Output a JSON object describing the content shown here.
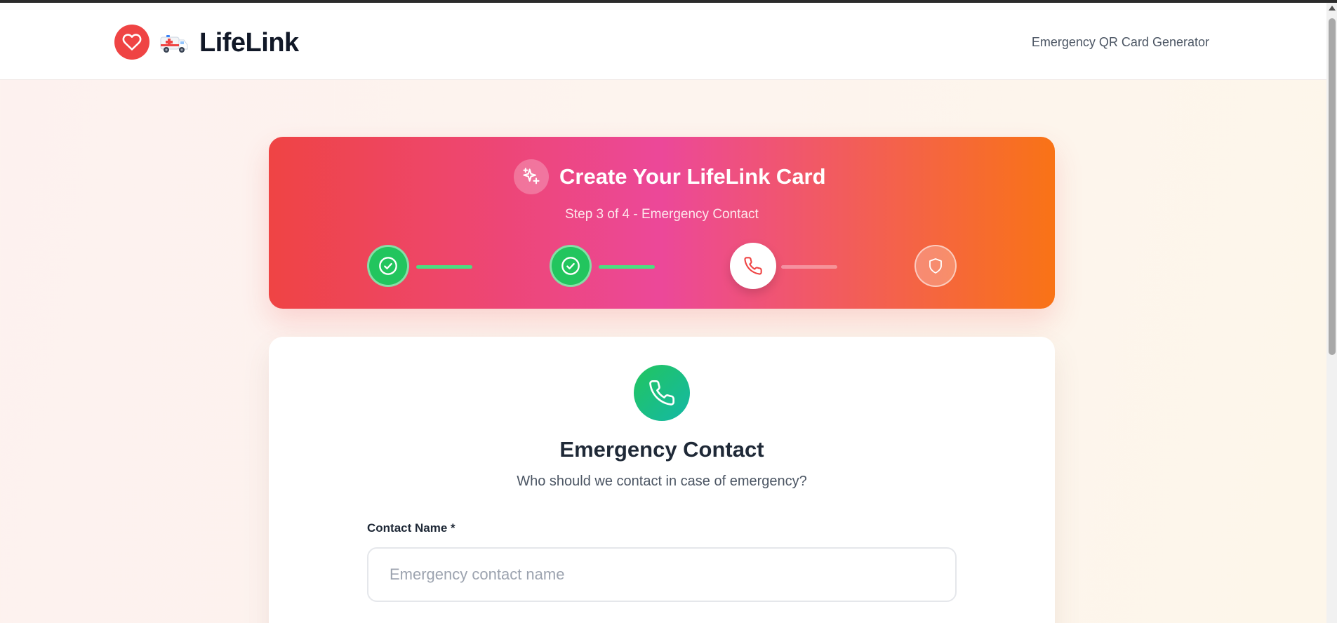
{
  "header": {
    "brand": "LifeLink",
    "tagline": "Emergency QR Card Generator",
    "icons": [
      "heart-icon",
      "ambulance-icon"
    ]
  },
  "hero": {
    "title": "Create Your LifeLink Card",
    "step_text": "Step 3 of 4 - Emergency Contact",
    "steps": [
      {
        "status": "completed",
        "icon": "check-circle-icon"
      },
      {
        "status": "completed",
        "icon": "check-circle-icon"
      },
      {
        "status": "current",
        "icon": "phone-icon"
      },
      {
        "status": "pending",
        "icon": "shield-icon"
      }
    ],
    "colors": {
      "gradient_start": "#ef4444",
      "gradient_mid": "#ec4899",
      "gradient_end": "#f97316",
      "done": "#22c55e"
    }
  },
  "form": {
    "title": "Emergency Contact",
    "subtitle": "Who should we contact in case of emergency?",
    "contact_name": {
      "label": "Contact Name *",
      "value": "",
      "placeholder": "Emergency contact name"
    }
  }
}
